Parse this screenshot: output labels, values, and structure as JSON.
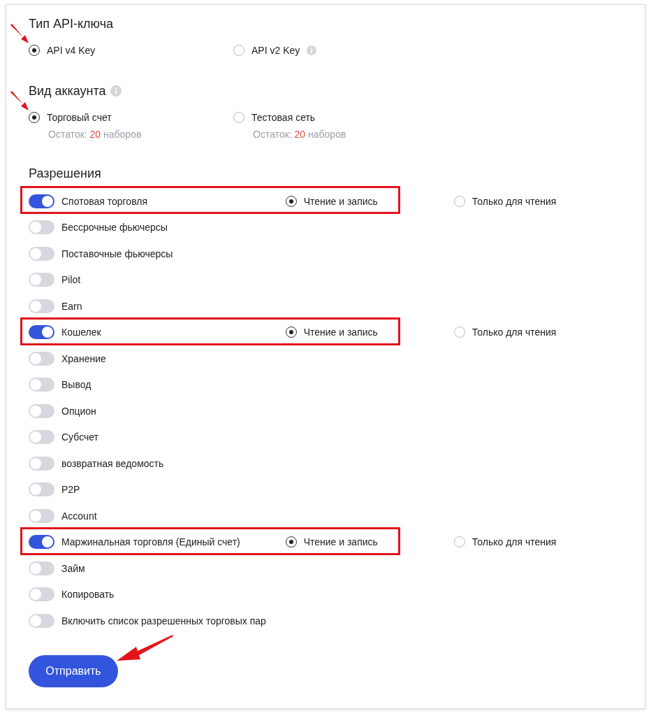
{
  "key_type": {
    "title": "Тип API-ключа",
    "options": [
      {
        "label": "API v4 Key",
        "selected": true,
        "info": false,
        "arrow": true
      },
      {
        "label": "API v2 Key",
        "selected": false,
        "info": true,
        "arrow": false
      }
    ]
  },
  "account_type": {
    "title": "Вид аккаунта",
    "info": true,
    "options": [
      {
        "label": "Торговый счет",
        "selected": true,
        "arrow": true,
        "remaining_label": "Остаток:",
        "remaining_count": "20",
        "remaining_unit": "наборов"
      },
      {
        "label": "Тестовая сеть",
        "selected": false,
        "arrow": false,
        "remaining_label": "Остаток:",
        "remaining_count": "20",
        "remaining_unit": "наборов"
      }
    ]
  },
  "permissions": {
    "title": "Разрешения",
    "items": [
      {
        "label": "Спотовая торговля",
        "on": true,
        "highlighted": true,
        "access": [
          {
            "label": "Чтение и запись",
            "selected": true
          },
          {
            "label": "Только для чтения",
            "selected": false
          }
        ]
      },
      {
        "label": "Бессрочные фьючерсы",
        "on": false,
        "highlighted": false
      },
      {
        "label": "Поставочные фьючерсы",
        "on": false,
        "highlighted": false
      },
      {
        "label": "Pilot",
        "on": false,
        "highlighted": false
      },
      {
        "label": "Earn",
        "on": false,
        "highlighted": false
      },
      {
        "label": "Кошелек",
        "on": true,
        "highlighted": true,
        "access": [
          {
            "label": "Чтение и запись",
            "selected": true
          },
          {
            "label": "Только для чтения",
            "selected": false
          }
        ]
      },
      {
        "label": "Хранение",
        "on": false,
        "highlighted": false
      },
      {
        "label": "Вывод",
        "on": false,
        "highlighted": false
      },
      {
        "label": "Опцион",
        "on": false,
        "highlighted": false
      },
      {
        "label": "Субсчет",
        "on": false,
        "highlighted": false
      },
      {
        "label": "возвратная ведомость",
        "on": false,
        "highlighted": false
      },
      {
        "label": "P2P",
        "on": false,
        "highlighted": false
      },
      {
        "label": "Account",
        "on": false,
        "highlighted": false
      },
      {
        "label": "Маржинальная торговля (Единый счет)",
        "on": true,
        "highlighted": true,
        "access": [
          {
            "label": "Чтение и запись",
            "selected": true
          },
          {
            "label": "Только для чтения",
            "selected": false
          }
        ]
      },
      {
        "label": "Займ",
        "on": false,
        "highlighted": false
      },
      {
        "label": "Копировать",
        "on": false,
        "highlighted": false
      },
      {
        "label": "Включить список разрешенных торговых пар",
        "on": false,
        "highlighted": false
      }
    ]
  },
  "submit": {
    "label": "Отправить",
    "arrow": true
  }
}
